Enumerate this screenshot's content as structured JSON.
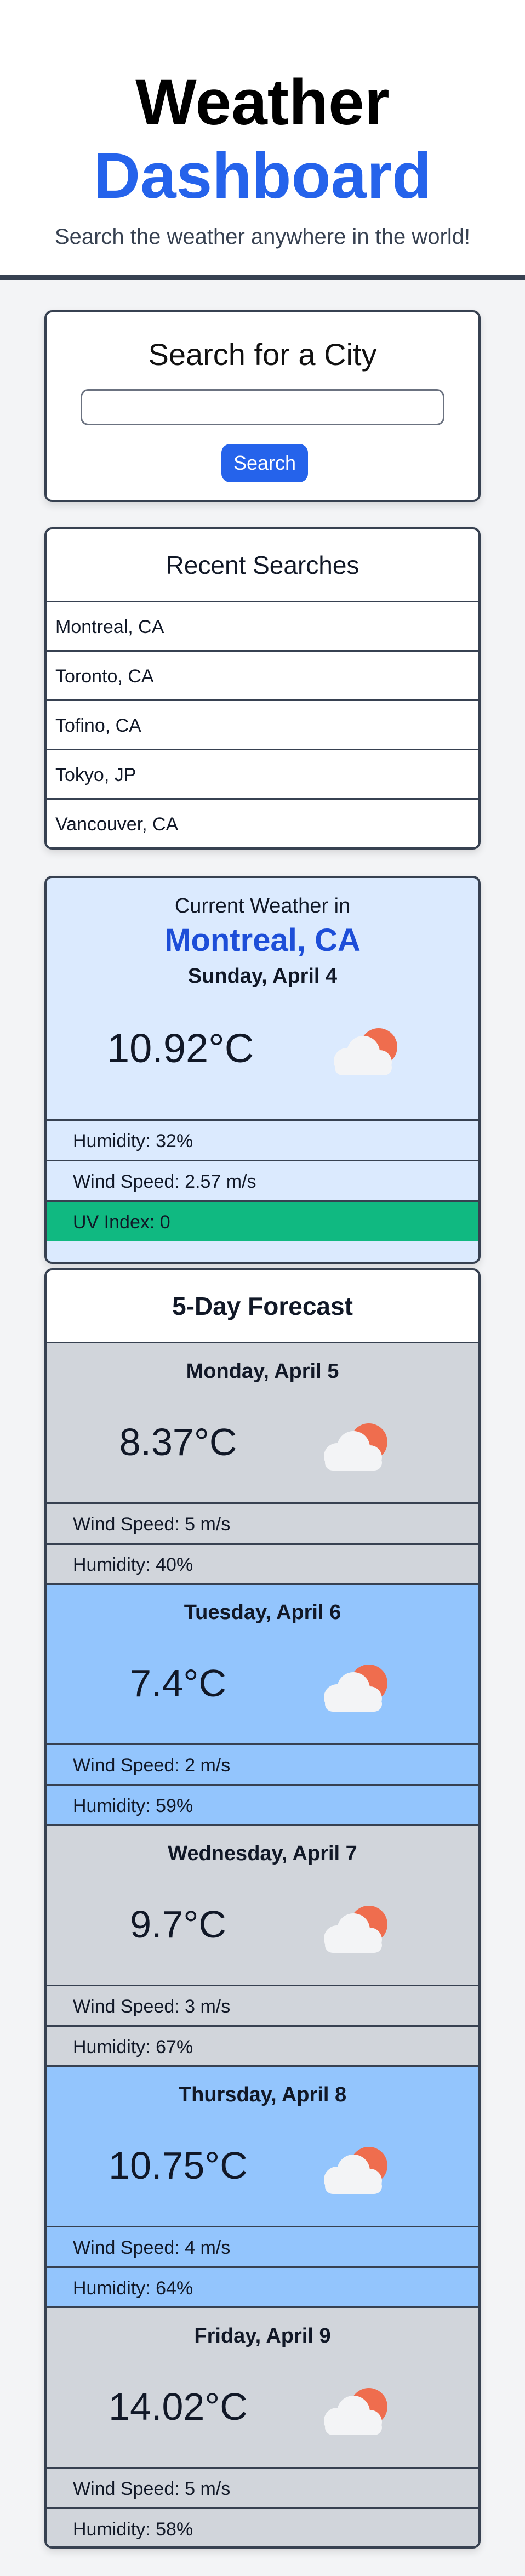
{
  "header": {
    "title_line1": "Weather",
    "title_line2": "Dashboard",
    "subtitle": "Search the weather anywhere in the world!"
  },
  "search": {
    "title": "Search for a City",
    "input_value": "",
    "button_label": "Search"
  },
  "recent": {
    "title": "Recent Searches",
    "items": [
      "Montreal, CA",
      "Toronto, CA",
      "Tofino, CA",
      "Tokyo, JP",
      "Vancouver, CA"
    ]
  },
  "current": {
    "label": "Current Weather in",
    "city": "Montreal, CA",
    "date": "Sunday, April 4",
    "temp": "10.92°C",
    "icon": "partly-cloudy-icon",
    "humidity": "Humidity: 32%",
    "wind": "Wind Speed: 2.57 m/s",
    "uv": "UV Index: 0",
    "uv_color": "#10b981"
  },
  "forecast": {
    "title": "5-Day Forecast",
    "days": [
      {
        "date": "Monday, April 5",
        "temp": "8.37°C",
        "wind": "Wind Speed: 5 m/s",
        "humidity": "Humidity: 40%"
      },
      {
        "date": "Tuesday, April 6",
        "temp": "7.4°C",
        "wind": "Wind Speed: 2 m/s",
        "humidity": "Humidity: 59%"
      },
      {
        "date": "Wednesday, April 7",
        "temp": "9.7°C",
        "wind": "Wind Speed: 3 m/s",
        "humidity": "Humidity: 67%"
      },
      {
        "date": "Thursday, April 8",
        "temp": "10.75°C",
        "wind": "Wind Speed: 4 m/s",
        "humidity": "Humidity: 64%"
      },
      {
        "date": "Friday, April 9",
        "temp": "14.02°C",
        "wind": "Wind Speed: 5 m/s",
        "humidity": "Humidity: 58%"
      }
    ]
  },
  "colors": {
    "accent": "#2563eb",
    "current_bg": "#dbeafe",
    "forecast_gray": "#d1d5db",
    "forecast_blue": "#93c5fd"
  }
}
